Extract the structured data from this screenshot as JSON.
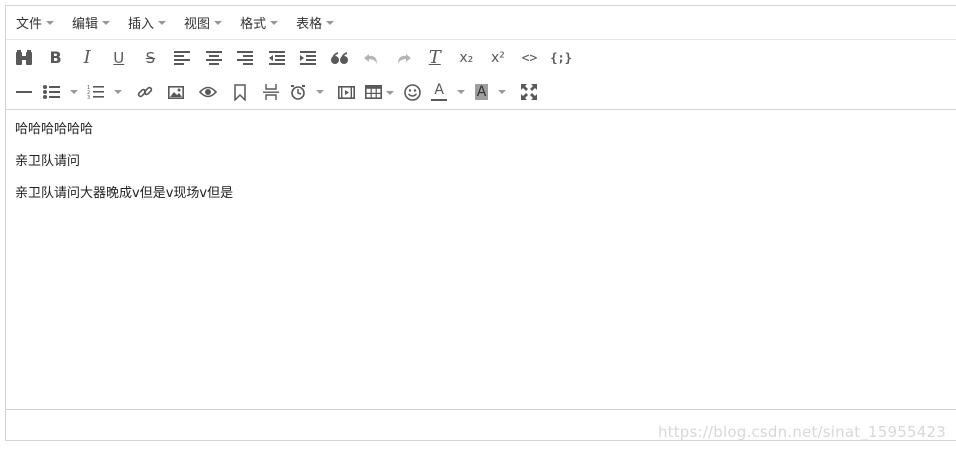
{
  "menubar": {
    "items": [
      {
        "label": "文件"
      },
      {
        "label": "编辑"
      },
      {
        "label": "插入"
      },
      {
        "label": "视图"
      },
      {
        "label": "格式"
      },
      {
        "label": "表格"
      }
    ]
  },
  "toolbar": {
    "row1": [
      "find-replace-icon",
      "bold-icon",
      "italic-icon",
      "underline-icon",
      "strikethrough-icon",
      "align-left-icon",
      "align-center-icon",
      "align-right-icon",
      "outdent-icon",
      "indent-icon",
      "blockquote-icon",
      "undo-icon",
      "redo-icon",
      "clear-formatting-icon",
      "subscript-icon",
      "superscript-icon",
      "code-icon",
      "code-sample-icon"
    ],
    "row2": [
      "horizontal-rule-icon",
      "bullet-list-icon",
      "numbered-list-icon",
      "link-icon",
      "image-icon",
      "preview-icon",
      "bookmark-icon",
      "page-break-icon",
      "time-icon",
      "media-icon",
      "table-icon",
      "emoticon-icon",
      "text-color-icon",
      "background-color-icon",
      "fullscreen-icon"
    ],
    "text_color_letter": "A",
    "bg_color_letter": "A",
    "bold_letter": "B",
    "italic_letter": "I",
    "underline_letter": "U",
    "strike_letter": "S",
    "clear_letter": "T",
    "sub_label": "x₂",
    "sup_label": "x²",
    "code_label": "<>",
    "code_sample_label": "{;}"
  },
  "content": {
    "paragraphs": [
      "哈哈哈哈哈哈",
      "亲卫队请问",
      "亲卫队请问大器晚成v但是v现场v但是"
    ]
  },
  "watermark": "https://blog.csdn.net/sinat_15955423"
}
